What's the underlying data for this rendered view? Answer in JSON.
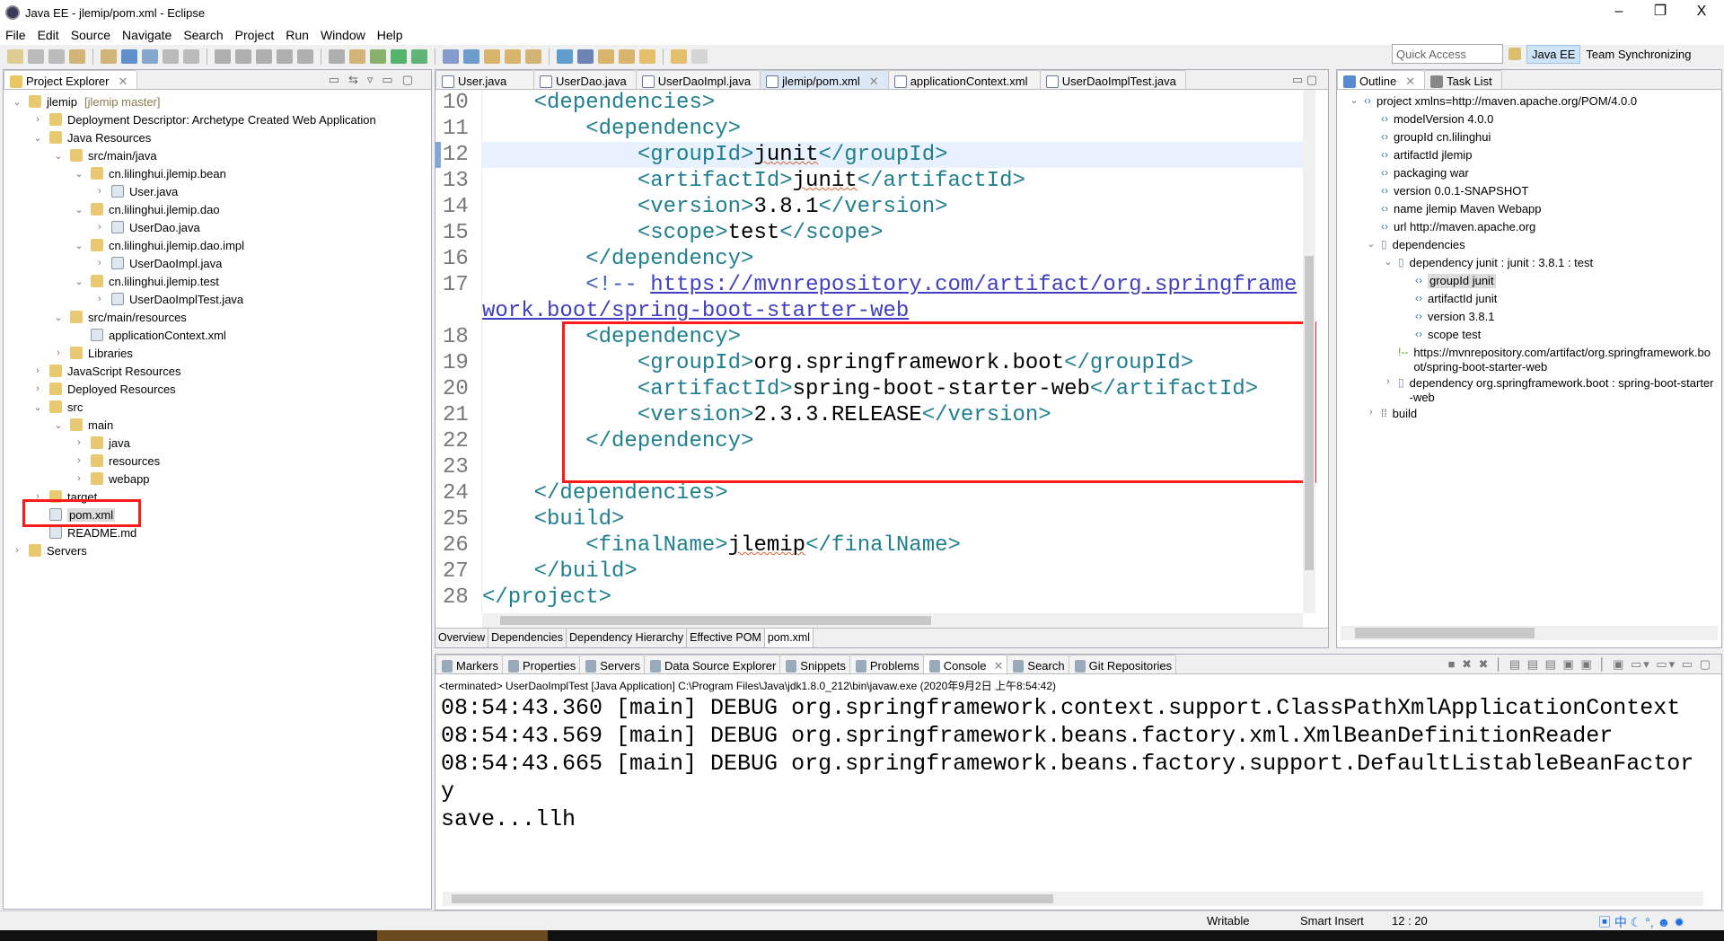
{
  "window": {
    "title": "Java EE - jlemip/pom.xml - Eclipse",
    "minimize": "–",
    "restore": "❐",
    "close": "X"
  },
  "menu": [
    "File",
    "Edit",
    "Source",
    "Navigate",
    "Search",
    "Project",
    "Run",
    "Window",
    "Help"
  ],
  "toolbar": {
    "quick_access_placeholder": "Quick Access",
    "perspectives": [
      "Java EE",
      "Team Synchronizing"
    ]
  },
  "project_explorer": {
    "title": "Project Explorer",
    "items": [
      {
        "label": "jlemip",
        "extra": "[jlemip master]",
        "depth": 0,
        "arrow": "v"
      },
      {
        "label": "Deployment Descriptor: Archetype Created Web Application",
        "depth": 1,
        "arrow": ">"
      },
      {
        "label": "Java Resources",
        "depth": 1,
        "arrow": "v"
      },
      {
        "label": "src/main/java",
        "depth": 2,
        "arrow": "v"
      },
      {
        "label": "cn.lilinghui.jlemip.bean",
        "depth": 3,
        "arrow": "v"
      },
      {
        "label": "User.java",
        "depth": 4,
        "arrow": ">"
      },
      {
        "label": "cn.lilinghui.jlemip.dao",
        "depth": 3,
        "arrow": "v"
      },
      {
        "label": "UserDao.java",
        "depth": 4,
        "arrow": ">"
      },
      {
        "label": "cn.lilinghui.jlemip.dao.impl",
        "depth": 3,
        "arrow": "v"
      },
      {
        "label": "UserDaoImpl.java",
        "depth": 4,
        "arrow": ">"
      },
      {
        "label": "cn.lilinghui.jlemip.test",
        "depth": 3,
        "arrow": "v"
      },
      {
        "label": "UserDaoImplTest.java",
        "depth": 4,
        "arrow": ">"
      },
      {
        "label": "src/main/resources",
        "depth": 2,
        "arrow": "v"
      },
      {
        "label": "applicationContext.xml",
        "depth": 3,
        "arrow": ""
      },
      {
        "label": "Libraries",
        "depth": 2,
        "arrow": ">"
      },
      {
        "label": "JavaScript Resources",
        "depth": 1,
        "arrow": ">"
      },
      {
        "label": "Deployed Resources",
        "depth": 1,
        "arrow": ">"
      },
      {
        "label": "src",
        "depth": 1,
        "arrow": "v"
      },
      {
        "label": "main",
        "depth": 2,
        "arrow": "v"
      },
      {
        "label": "java",
        "depth": 3,
        "arrow": ">"
      },
      {
        "label": "resources",
        "depth": 3,
        "arrow": ">"
      },
      {
        "label": "webapp",
        "depth": 3,
        "arrow": ">"
      },
      {
        "label": "target",
        "depth": 1,
        "arrow": ">"
      },
      {
        "label": "pom.xml",
        "depth": 1,
        "arrow": "",
        "selected": true
      },
      {
        "label": "README.md",
        "depth": 1,
        "arrow": ""
      },
      {
        "label": "Servers",
        "depth": 0,
        "arrow": ">"
      }
    ]
  },
  "editor": {
    "tabs": [
      "User.java",
      "UserDao.java",
      "UserDaoImpl.java",
      "jlemip/pom.xml",
      "applicationContext.xml",
      "UserDaoImplTest.java"
    ],
    "active_tab": 3,
    "bottom_tabs": [
      "Overview",
      "Dependencies",
      "Dependency Hierarchy",
      "Effective POM",
      "pom.xml"
    ],
    "current_line": 12,
    "lines": [
      {
        "n": "10",
        "segs": [
          {
            "t": "    "
          },
          {
            "t": "<dependencies>",
            "c": "tag"
          }
        ]
      },
      {
        "n": "11",
        "segs": [
          {
            "t": "        "
          },
          {
            "t": "<dependency>",
            "c": "tag"
          }
        ]
      },
      {
        "n": "12",
        "segs": [
          {
            "t": "            "
          },
          {
            "t": "<groupId>",
            "c": "tag"
          },
          {
            "t": "junit",
            "c": "txt sq"
          },
          {
            "t": "</groupId>",
            "c": "tag"
          }
        ]
      },
      {
        "n": "13",
        "segs": [
          {
            "t": "            "
          },
          {
            "t": "<artifactId>",
            "c": "tag"
          },
          {
            "t": "junit",
            "c": "txt sq"
          },
          {
            "t": "</artifactId>",
            "c": "tag"
          }
        ]
      },
      {
        "n": "14",
        "segs": [
          {
            "t": "            "
          },
          {
            "t": "<version>",
            "c": "tag"
          },
          {
            "t": "3.8.1",
            "c": "txt"
          },
          {
            "t": "</version>",
            "c": "tag"
          }
        ]
      },
      {
        "n": "15",
        "segs": [
          {
            "t": "            "
          },
          {
            "t": "<scope>",
            "c": "tag"
          },
          {
            "t": "test",
            "c": "txt"
          },
          {
            "t": "</scope>",
            "c": "tag"
          }
        ]
      },
      {
        "n": "16",
        "segs": [
          {
            "t": "        "
          },
          {
            "t": "</dependency>",
            "c": "tag"
          }
        ]
      },
      {
        "n": "17",
        "segs": [
          {
            "t": "        "
          },
          {
            "t": "<!-- ",
            "c": "cm"
          },
          {
            "t": "https://mvnrepository.com/artifact/org.springframework.boot/spring-boot-starter-web",
            "c": "lnk"
          }
        ]
      },
      {
        "n": "18",
        "segs": [
          {
            "t": "        "
          },
          {
            "t": "<dependency>",
            "c": "tag"
          }
        ]
      },
      {
        "n": "19",
        "segs": [
          {
            "t": "            "
          },
          {
            "t": "<groupId>",
            "c": "tag"
          },
          {
            "t": "org.springframework.boot",
            "c": "txt"
          },
          {
            "t": "</groupId>",
            "c": "tag"
          }
        ]
      },
      {
        "n": "20",
        "segs": [
          {
            "t": "            "
          },
          {
            "t": "<artifactId>",
            "c": "tag"
          },
          {
            "t": "spring-boot-starter-web",
            "c": "txt"
          },
          {
            "t": "</artifactId>",
            "c": "tag"
          }
        ]
      },
      {
        "n": "21",
        "segs": [
          {
            "t": "            "
          },
          {
            "t": "<version>",
            "c": "tag"
          },
          {
            "t": "2.3.3.RELEASE",
            "c": "txt"
          },
          {
            "t": "</version>",
            "c": "tag"
          }
        ]
      },
      {
        "n": "22",
        "segs": [
          {
            "t": "        "
          },
          {
            "t": "</dependency>",
            "c": "tag"
          }
        ]
      },
      {
        "n": "23",
        "segs": [
          {
            "t": ""
          }
        ]
      },
      {
        "n": "24",
        "segs": [
          {
            "t": "    "
          },
          {
            "t": "</dependencies>",
            "c": "tag"
          }
        ]
      },
      {
        "n": "25",
        "segs": [
          {
            "t": "    "
          },
          {
            "t": "<build>",
            "c": "tag"
          }
        ]
      },
      {
        "n": "26",
        "segs": [
          {
            "t": "        "
          },
          {
            "t": "<finalName>",
            "c": "tag"
          },
          {
            "t": "jlemip",
            "c": "txt sq"
          },
          {
            "t": "</finalName>",
            "c": "tag"
          }
        ]
      },
      {
        "n": "27",
        "segs": [
          {
            "t": "    "
          },
          {
            "t": "</build>",
            "c": "tag"
          }
        ]
      },
      {
        "n": "28",
        "segs": [
          {
            "t": "</project>",
            "c": "tag"
          }
        ]
      }
    ]
  },
  "outline": {
    "tabs": [
      "Outline",
      "Task List"
    ],
    "items": [
      {
        "label": "project xmlns=http://maven.apache.org/POM/4.0.0",
        "depth": 0,
        "arrow": "v",
        "icon": "<>"
      },
      {
        "label": "modelVersion  4.0.0",
        "depth": 1,
        "arrow": "",
        "icon": "<>"
      },
      {
        "label": "groupId  cn.lilinghui",
        "depth": 1,
        "arrow": "",
        "icon": "<>"
      },
      {
        "label": "artifactId  jlemip",
        "depth": 1,
        "arrow": "",
        "icon": "<>"
      },
      {
        "label": "packaging  war",
        "depth": 1,
        "arrow": "",
        "icon": "<>"
      },
      {
        "label": "version  0.0.1-SNAPSHOT",
        "depth": 1,
        "arrow": "",
        "icon": "<>"
      },
      {
        "label": "name  jlemip Maven Webapp",
        "depth": 1,
        "arrow": "",
        "icon": "<>"
      },
      {
        "label": "url  http://maven.apache.org",
        "depth": 1,
        "arrow": "",
        "icon": "<>"
      },
      {
        "label": "dependencies",
        "depth": 1,
        "arrow": "v",
        "icon": "jar"
      },
      {
        "label": "dependency  junit : junit : 3.8.1 : test",
        "depth": 2,
        "arrow": "v",
        "icon": "jar"
      },
      {
        "label": "groupId  junit",
        "depth": 3,
        "arrow": "",
        "icon": "<>",
        "selected": true
      },
      {
        "label": "artifactId  junit",
        "depth": 3,
        "arrow": "",
        "icon": "<>"
      },
      {
        "label": "version  3.8.1",
        "depth": 3,
        "arrow": "",
        "icon": "<>"
      },
      {
        "label": "scope  test",
        "depth": 3,
        "arrow": "",
        "icon": "<>"
      },
      {
        "label": "https://mvnrepository.com/artifact/org.springframework.boot/spring-boot-starter-web",
        "depth": 2,
        "arrow": "",
        "icon": "!--"
      },
      {
        "label": "dependency  org.springframework.boot : spring-boot-starter-web",
        "depth": 2,
        "arrow": ">",
        "icon": "jar"
      },
      {
        "label": "build",
        "depth": 1,
        "arrow": ">",
        "icon": "1010"
      }
    ]
  },
  "bottom_panel": {
    "tabs": [
      "Markers",
      "Properties",
      "Servers",
      "Data Source Explorer",
      "Snippets",
      "Problems",
      "Console",
      "Search",
      "Git Repositories"
    ],
    "active_tab": 6,
    "console_header": "<terminated> UserDaoImplTest [Java Application] C:\\Program Files\\Java\\jdk1.8.0_212\\bin\\javaw.exe (2020年9月2日 上午8:54:42)",
    "console_lines": [
      "08:54:43.360 [main] DEBUG org.springframework.context.support.ClassPathXmlApplicationContext",
      "08:54:43.569 [main] DEBUG org.springframework.beans.factory.xml.XmlBeanDefinitionReader",
      "08:54:43.665 [main] DEBUG org.springframework.beans.factory.support.DefaultListableBeanFactory",
      "save...llh"
    ]
  },
  "status": {
    "writable": "Writable",
    "insert_mode": "Smart Insert",
    "position": "12 : 20"
  },
  "ime": {
    "lang": "中"
  },
  "colors": {
    "highlight_box": "#ff1a1a",
    "tag": "#1f7f8f",
    "comment": "#3f5fbf",
    "current_line": "#e8f2fe",
    "selection": "#dcdcdc"
  }
}
